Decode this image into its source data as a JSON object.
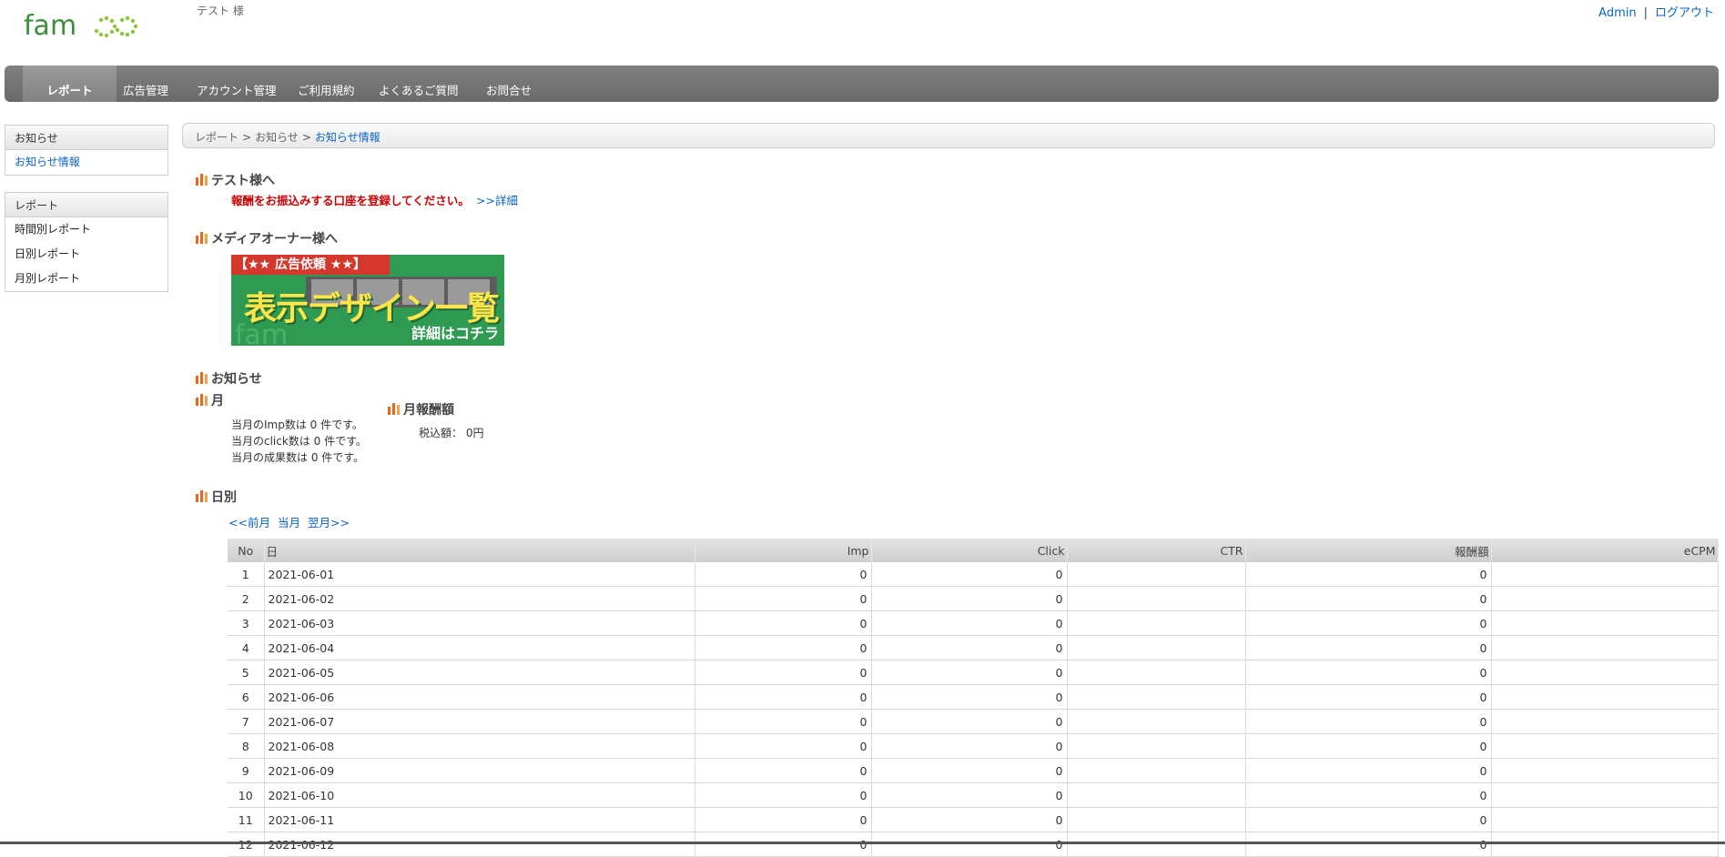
{
  "header": {
    "logo_text": "fam",
    "user_name": "テスト 様",
    "admin_link": "Admin",
    "separator": "|",
    "logout_link": "ログアウト"
  },
  "nav": {
    "items": [
      {
        "label": "レポート"
      },
      {
        "label": "広告管理"
      },
      {
        "label": "アカウント管理"
      },
      {
        "label": "ご利用規約"
      },
      {
        "label": "よくあるご質問"
      },
      {
        "label": "お問合せ"
      }
    ]
  },
  "sidebar": {
    "notice_box": {
      "title": "お知らせ",
      "items": [
        "お知らせ情報"
      ]
    },
    "report_box": {
      "title": "レポート",
      "items": [
        "時間別レポート",
        "日別レポート",
        "月別レポート"
      ]
    }
  },
  "breadcrumb": {
    "items": [
      "レポート",
      "お知らせ",
      "お知らせ情報"
    ],
    "separator": ">"
  },
  "to_user": {
    "heading": "テスト様へ",
    "notice": "報酬をお振込みする口座を登録してください。",
    "detail_link": ">>詳細"
  },
  "media_owner": {
    "heading": "メディアオーナー様へ",
    "banner": {
      "top": "【★★ 広告依頼 ★★】",
      "main": "表示デザイン一覧",
      "sub": "詳細はコチラ",
      "watermark": "fam"
    }
  },
  "notice_section": {
    "heading": "お知らせ",
    "month_heading": "月",
    "month_lines": [
      "当月のImp数は 0 件です。",
      "当月のclick数は 0 件です。",
      "当月の成果数は 0 件です。"
    ],
    "reward_heading": "月報酬額",
    "reward_value": "税込額： 0円"
  },
  "daily": {
    "heading": "日別",
    "nav": {
      "prev": "<<前月",
      "current": "当月",
      "next": "翌月>>"
    },
    "columns": [
      "No",
      "日",
      "Imp",
      "Click",
      "CTR",
      "報酬額",
      "eCPM"
    ],
    "rows": [
      {
        "no": "1",
        "date": "2021-06-01",
        "imp": "0",
        "click": "0",
        "ctr": "",
        "reward": "0",
        "ecpm": ""
      },
      {
        "no": "2",
        "date": "2021-06-02",
        "imp": "0",
        "click": "0",
        "ctr": "",
        "reward": "0",
        "ecpm": ""
      },
      {
        "no": "3",
        "date": "2021-06-03",
        "imp": "0",
        "click": "0",
        "ctr": "",
        "reward": "0",
        "ecpm": ""
      },
      {
        "no": "4",
        "date": "2021-06-04",
        "imp": "0",
        "click": "0",
        "ctr": "",
        "reward": "0",
        "ecpm": ""
      },
      {
        "no": "5",
        "date": "2021-06-05",
        "imp": "0",
        "click": "0",
        "ctr": "",
        "reward": "0",
        "ecpm": ""
      },
      {
        "no": "6",
        "date": "2021-06-06",
        "imp": "0",
        "click": "0",
        "ctr": "",
        "reward": "0",
        "ecpm": ""
      },
      {
        "no": "7",
        "date": "2021-06-07",
        "imp": "0",
        "click": "0",
        "ctr": "",
        "reward": "0",
        "ecpm": ""
      },
      {
        "no": "8",
        "date": "2021-06-08",
        "imp": "0",
        "click": "0",
        "ctr": "",
        "reward": "0",
        "ecpm": ""
      },
      {
        "no": "9",
        "date": "2021-06-09",
        "imp": "0",
        "click": "0",
        "ctr": "",
        "reward": "0",
        "ecpm": ""
      },
      {
        "no": "10",
        "date": "2021-06-10",
        "imp": "0",
        "click": "0",
        "ctr": "",
        "reward": "0",
        "ecpm": ""
      },
      {
        "no": "11",
        "date": "2021-06-11",
        "imp": "0",
        "click": "0",
        "ctr": "",
        "reward": "0",
        "ecpm": ""
      },
      {
        "no": "12",
        "date": "2021-06-12",
        "imp": "0",
        "click": "0",
        "ctr": "",
        "reward": "0",
        "ecpm": ""
      }
    ]
  },
  "colors": {
    "nav_bg": "#6e6e6e",
    "link": "#0a64c8",
    "alert": "#cc0000",
    "heading_bars": "#e8681a",
    "banner_green": "#2e9a52"
  }
}
